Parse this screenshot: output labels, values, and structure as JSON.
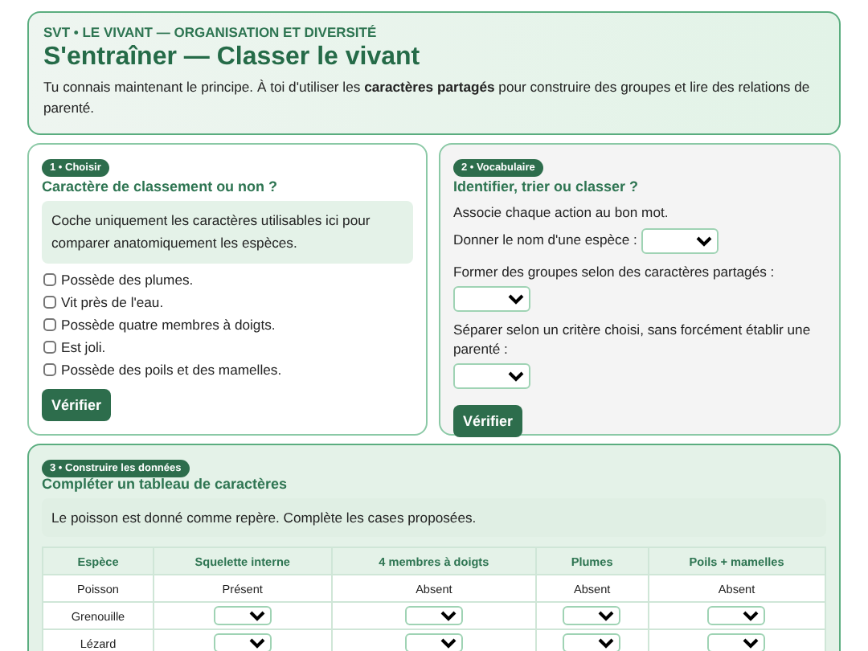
{
  "header": {
    "kicker": "SVT • LE VIVANT — ORGANISATION ET DIVERSITÉ",
    "title": "S'entraîner — Classer le vivant",
    "intro": "Tu connais maintenant le principe. À toi d'utiliser les **caractères partagés** pour construire des groupes et lire des relations de parenté."
  },
  "exercises": [
    {
      "badge": "1 • Choisir",
      "title": "Caractère de classement ou non ?",
      "hint": "Coche uniquement les caractères utilisables ici pour comparer anatomiquement les espèces.",
      "options": [
        {
          "label": "Possède des plumes.",
          "checked": false
        },
        {
          "label": "Vit près de l'eau.",
          "checked": false
        },
        {
          "label": "Possède quatre membres à doigts.",
          "checked": false
        },
        {
          "label": "Est joli.",
          "checked": false
        },
        {
          "label": "Possède des poils et des mamelles.",
          "checked": false
        }
      ],
      "button": "Vérifier"
    },
    {
      "badge": "2 • Vocabulaire",
      "title": "Identifier, trier ou classer ?",
      "instruction": "Associe chaque action au bon mot.",
      "questions": [
        "Donner le nom d'une espèce :",
        "Former des groupes selon des caractères partagés :",
        "Séparer selon un critère choisi, sans forcément établir une parenté :"
      ],
      "button": "Vérifier"
    }
  ],
  "table_exercise": {
    "badge": "3 • Construire les données",
    "title": "Compléter un tableau de caractères",
    "hint": "Le poisson est donné comme repère. Complète les cases proposées.",
    "columns": [
      "Espèce",
      "Squelette interne",
      "4 membres à doigts",
      "Plumes",
      "Poils + mamelles"
    ],
    "rows": [
      {
        "cells": [
          {
            "kind": "text",
            "text": "Poisson"
          },
          {
            "kind": "text",
            "text": "Présent"
          },
          {
            "kind": "text",
            "text": "Absent"
          },
          {
            "kind": "text",
            "text": "Absent"
          },
          {
            "kind": "text",
            "text": "Absent"
          }
        ]
      },
      {
        "cells": [
          {
            "kind": "text",
            "text": "Grenouille"
          },
          {
            "kind": "select"
          },
          {
            "kind": "select"
          },
          {
            "kind": "select"
          },
          {
            "kind": "select"
          }
        ]
      },
      {
        "cells": [
          {
            "kind": "text",
            "text": "Lézard"
          },
          {
            "kind": "select"
          },
          {
            "kind": "select"
          },
          {
            "kind": "select"
          },
          {
            "kind": "select"
          }
        ]
      }
    ]
  }
}
